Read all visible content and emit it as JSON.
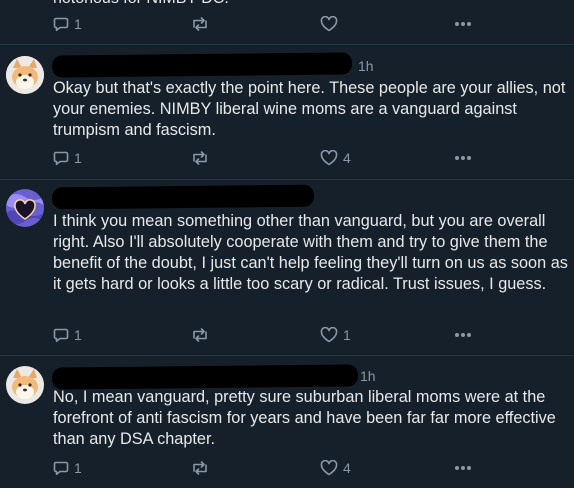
{
  "colors": {
    "background": "#15202b",
    "text": "#e7e9ea",
    "muted": "#8b98a5",
    "divider": "#243447"
  },
  "top_post": {
    "text_fragment": "notorious for NIMBY DC.",
    "reply_count": "1",
    "repost_icon": "repost-icon",
    "like_icon": "heart-icon",
    "more_icon": "more-dots-icon"
  },
  "posts": [
    {
      "time": "1h",
      "text": "Okay but that's exactly the point here. These people are your allies, not your enemies. NIMBY liberal wine moms are a vanguard against trumpism and fascism.",
      "reply_count": "1",
      "like_count": "4"
    },
    {
      "time": "",
      "text": "I think you mean something other than vanguard, but you are overall right. Also I'll absolutely cooperate with them and try to give them the benefit of the doubt, I just can't help feeling they'll turn on us as soon as it gets hard or looks a little too scary or radical. Trust issues, I guess.",
      "reply_count": "1",
      "like_count": "1"
    },
    {
      "time": "1h",
      "text": "No, I mean vanguard, pretty sure suburban liberal moms were at the forefront of anti fascism for years and have been far far more effective than any DSA chapter.",
      "reply_count": "1",
      "like_count": "4"
    }
  ]
}
